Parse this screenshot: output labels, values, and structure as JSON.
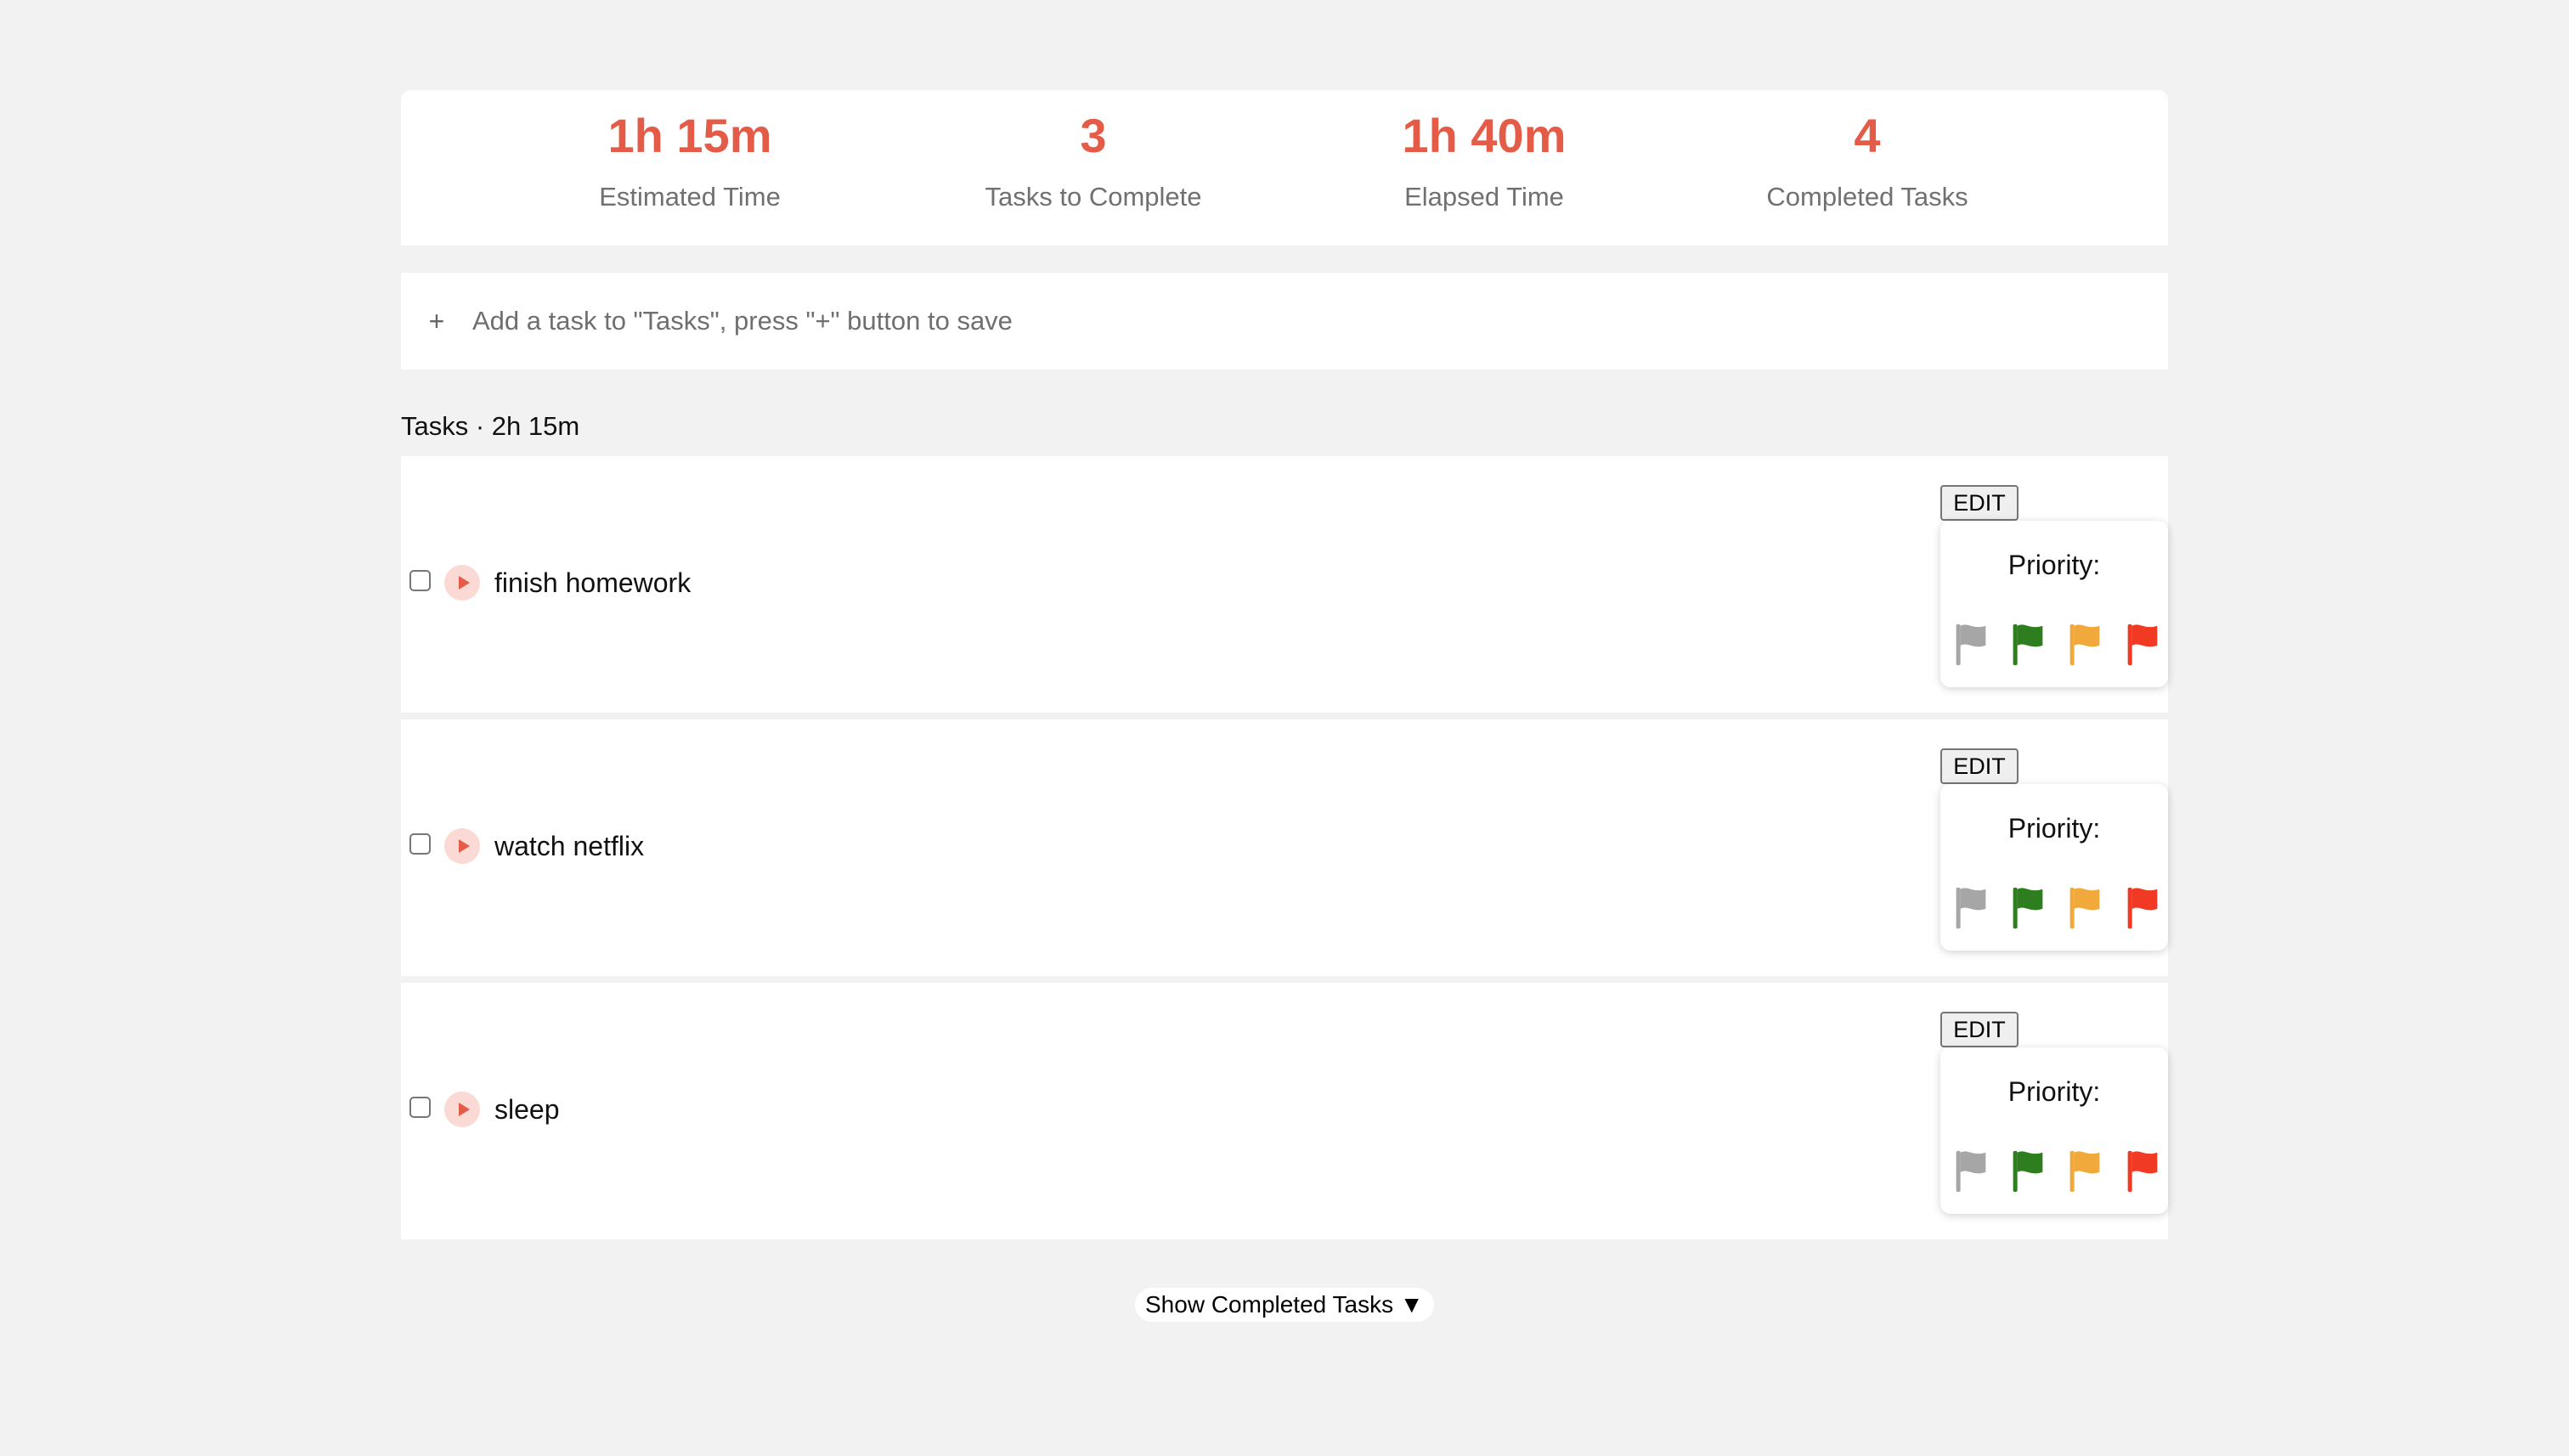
{
  "stats": [
    {
      "value": "1h 15m",
      "label": "Estimated Time"
    },
    {
      "value": "3",
      "label": "Tasks to Complete"
    },
    {
      "value": "1h 40m",
      "label": "Elapsed Time"
    },
    {
      "value": "4",
      "label": "Completed Tasks"
    }
  ],
  "add_task": {
    "icon": "+",
    "placeholder": "Add a task to \"Tasks\", press \"+\" button to save"
  },
  "section": {
    "title": "Tasks · 2h 15m"
  },
  "tasks": [
    {
      "name": "finish homework",
      "checked": false,
      "edit_label": "EDIT",
      "priority_label": "Priority:"
    },
    {
      "name": "watch netflix",
      "checked": false,
      "edit_label": "EDIT",
      "priority_label": "Priority:"
    },
    {
      "name": "sleep",
      "checked": false,
      "edit_label": "EDIT",
      "priority_label": "Priority:"
    }
  ],
  "priority_flags": [
    {
      "name": "none",
      "color": "#a6a6a6",
      "icon": "flag-icon"
    },
    {
      "name": "low",
      "color": "#2e7d1f",
      "icon": "flag-icon"
    },
    {
      "name": "medium",
      "color": "#f2a93b",
      "icon": "flag-icon"
    },
    {
      "name": "high",
      "color": "#f03a24",
      "icon": "flag-icon"
    }
  ],
  "colors": {
    "accent": "#e45c47",
    "background": "#f2f2f2"
  },
  "footer": {
    "show_completed_label": "Show Completed Tasks ▼"
  }
}
